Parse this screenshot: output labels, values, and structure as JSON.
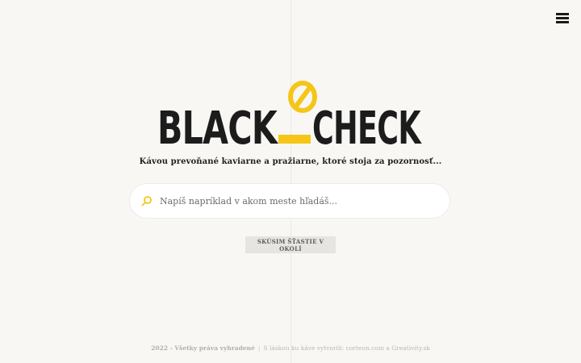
{
  "brand": {
    "logo_left": "BLACK",
    "logo_right": "CHECK",
    "accent": "#f5c518",
    "ink": "#1c1c1c"
  },
  "tagline": "Kávou prevoňané kaviarne a pražiarne, ktoré stoja za pozornosť...",
  "search": {
    "icon": "search-icon",
    "placeholder": "Napíš napríklad v akom meste hľadáš..."
  },
  "lucky_button": "SKÚSIM ŠŤASTIE V OKOLÍ",
  "menu": {
    "icon": "hamburger-icon"
  },
  "footer": {
    "copyright": "2022 - Všetky práva vyhradené",
    "separator": "|",
    "credits": "S láskou ku káve vytvorili: corteon.com a Greativity.sk"
  }
}
